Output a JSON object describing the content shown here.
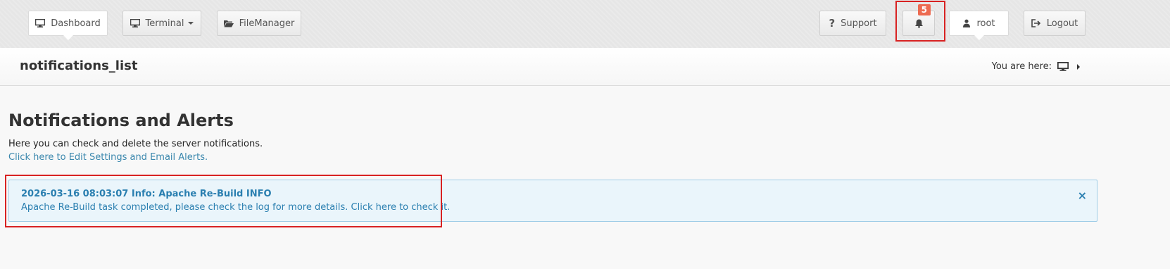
{
  "topbar": {
    "dashboard_label": "Dashboard",
    "terminal_label": "Terminal",
    "filemanager_label": "FileManager",
    "support_label": "Support",
    "notifications_count": "5",
    "user_label": "root",
    "logout_label": "Logout"
  },
  "page_header": {
    "title": "notifications_list",
    "breadcrumb_label": "You are here:"
  },
  "main": {
    "heading": "Notifications and Alerts",
    "description": "Here you can check and delete the server notifications.",
    "settings_link": "Click here to Edit Settings and Email Alerts."
  },
  "alert": {
    "title": "2026-03-16 08:03:07 Info: Apache Re-Build INFO",
    "message_prefix": "Apache Re-Build task completed, please check the log for more details.",
    "message_link": "Click here to check it.",
    "close_symbol": "×"
  },
  "icons": {
    "dashboard": "monitor-icon",
    "terminal": "monitor-icon",
    "filemanager": "folder-open-icon",
    "support": "question-icon",
    "notifications": "bell-icon",
    "user": "user-icon",
    "logout": "logout-icon",
    "breadcrumb": "monitor-icon"
  },
  "colors": {
    "accent": "#3a87ad",
    "alert_text": "#2a7fb0",
    "alert_background": "#eaf5fb",
    "badge": "#ed6b51",
    "highlight": "#d82222"
  }
}
